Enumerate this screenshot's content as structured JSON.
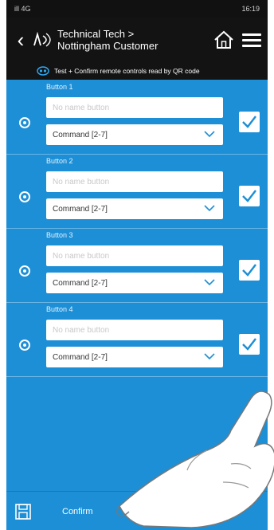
{
  "statusbar": {
    "left": "ill 4G",
    "right": "16:19"
  },
  "header": {
    "title_line1": "Technical Tech >",
    "title_line2": "Nottingham Customer",
    "subtitle": "Test + Confirm remote controls read by QR code"
  },
  "buttons": [
    {
      "label": "Button 1",
      "name_placeholder": "No name button",
      "command": "Command [2-7]"
    },
    {
      "label": "Button 2",
      "name_placeholder": "No name button",
      "command": "Command [2-7]"
    },
    {
      "label": "Button 3",
      "name_placeholder": "No name button",
      "command": "Command [2-7]"
    },
    {
      "label": "Button 4",
      "name_placeholder": "No name button",
      "command": "Command [2-7]"
    }
  ],
  "footer": {
    "confirm_label": "Confirm",
    "cancel_label": "Cancel"
  },
  "colors": {
    "accent": "#1d8fd6",
    "header": "#131313"
  },
  "icons": [
    "back-icon",
    "technical-tech-icon",
    "home-icon",
    "menu-icon",
    "remote-icon",
    "chevron-down-icon",
    "checkmark-icon",
    "save-icon",
    "close-icon"
  ]
}
